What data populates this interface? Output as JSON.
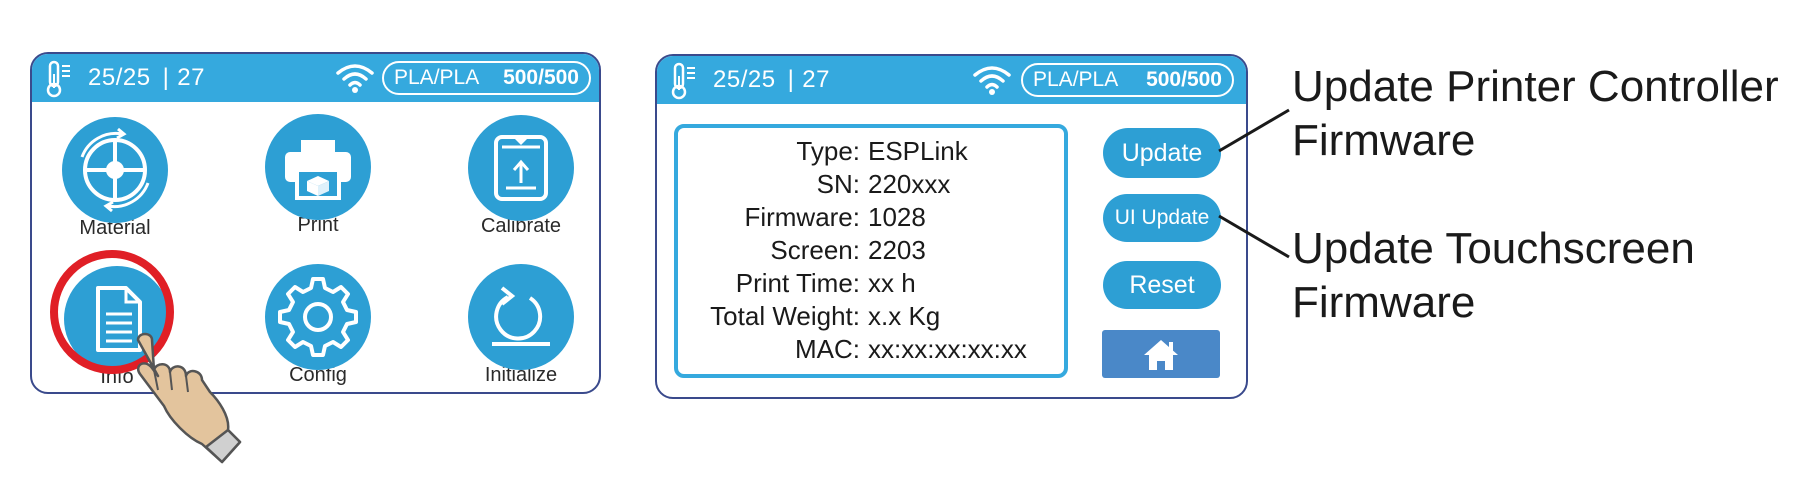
{
  "status": {
    "temperature": "25/25",
    "value": "27",
    "material": "PLA/PLA",
    "count": "500/500"
  },
  "home_menu": {
    "tiles": [
      {
        "label": "Material",
        "icon": "filament-spool-icon"
      },
      {
        "label": "Print",
        "icon": "printer-icon"
      },
      {
        "label": "Calibrate",
        "icon": "calibrate-icon"
      },
      {
        "label": "Info",
        "icon": "document-icon"
      },
      {
        "label": "Config",
        "icon": "gear-icon"
      },
      {
        "label": "Initialize",
        "icon": "reset-arrow-icon"
      }
    ]
  },
  "info_screen": {
    "fields": [
      {
        "key": "Type:",
        "value": "ESPLink"
      },
      {
        "key": "SN:",
        "value": "220xxx"
      },
      {
        "key": "Firmware:",
        "value": "1028"
      },
      {
        "key": "Screen:",
        "value": "2203"
      },
      {
        "key": "Print Time:",
        "value": "xx h"
      },
      {
        "key": "Total Weight:",
        "value": "x.x Kg"
      },
      {
        "key": "MAC:",
        "value": "xx:xx:xx:xx:xx"
      }
    ],
    "buttons": {
      "update": "Update",
      "ui_update": "UI Update",
      "reset": "Reset",
      "home_icon": "home-icon"
    }
  },
  "annotations": {
    "update_line1": "Update Printer Controller",
    "update_line2": "Firmware",
    "ui_line1": "Update Touchscreen",
    "ui_line2": "Firmware"
  },
  "colors": {
    "accent": "#35a9de",
    "tile": "#2d9fd4",
    "home_button": "#4a88c8",
    "highlight_ring": "#e01f26",
    "frame": "#3a4a8c"
  }
}
